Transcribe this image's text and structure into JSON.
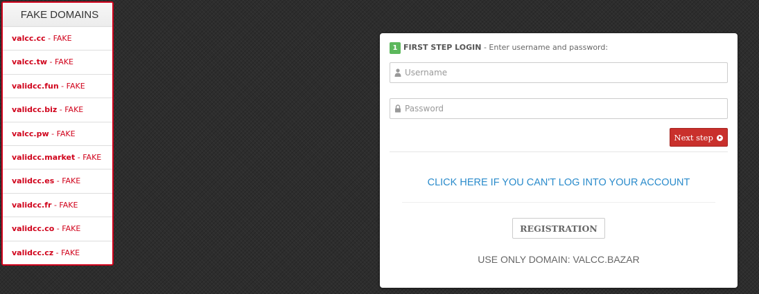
{
  "fake_panel": {
    "title": "FAKE DOMAINS",
    "items": [
      {
        "domain": "valcc.cc",
        "suffix": " - FAKE"
      },
      {
        "domain": "valcc.tw",
        "suffix": " - FAKE"
      },
      {
        "domain": "validcc.fun",
        "suffix": " - FAKE"
      },
      {
        "domain": "validcc.biz",
        "suffix": " - FAKE"
      },
      {
        "domain": "valcc.pw",
        "suffix": " - FAKE"
      },
      {
        "domain": "validcc.market",
        "suffix": " - FAKE"
      },
      {
        "domain": "validcc.es",
        "suffix": " - FAKE"
      },
      {
        "domain": "validcc.fr",
        "suffix": " - FAKE"
      },
      {
        "domain": "validcc.co",
        "suffix": " - FAKE"
      },
      {
        "domain": "validcc.cz",
        "suffix": " - FAKE"
      }
    ]
  },
  "login": {
    "step_number": "1",
    "step_title": "FIRST STEP LOGIN",
    "step_desc": " - Enter username and password:",
    "username_placeholder": "Username",
    "username_value": "",
    "password_placeholder": "Password",
    "password_value": "",
    "next_label": "Next step",
    "help_link": "CLICK HERE IF YOU CAN'T LOG INTO YOUR ACCOUNT",
    "registration_label": "REGISTRATION",
    "domain_note": "USE ONLY DOMAIN: VALCC.BAZAR"
  },
  "icons": {
    "user": "user-icon",
    "lock": "lock-icon",
    "next": "arrow-circle-right-icon"
  },
  "colors": {
    "fake_red": "#d0021b",
    "step_green": "#5cb85c",
    "next_red": "#c9302c",
    "link_blue": "#2a8bcb"
  }
}
